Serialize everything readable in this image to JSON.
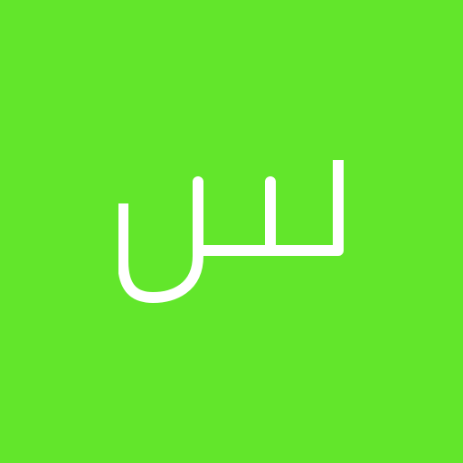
{
  "avatar": {
    "background_color": "#62e62b",
    "foreground_color": "#ffffff",
    "letter": "س",
    "letter_icon": "arabic-letter-seen-glyph"
  }
}
